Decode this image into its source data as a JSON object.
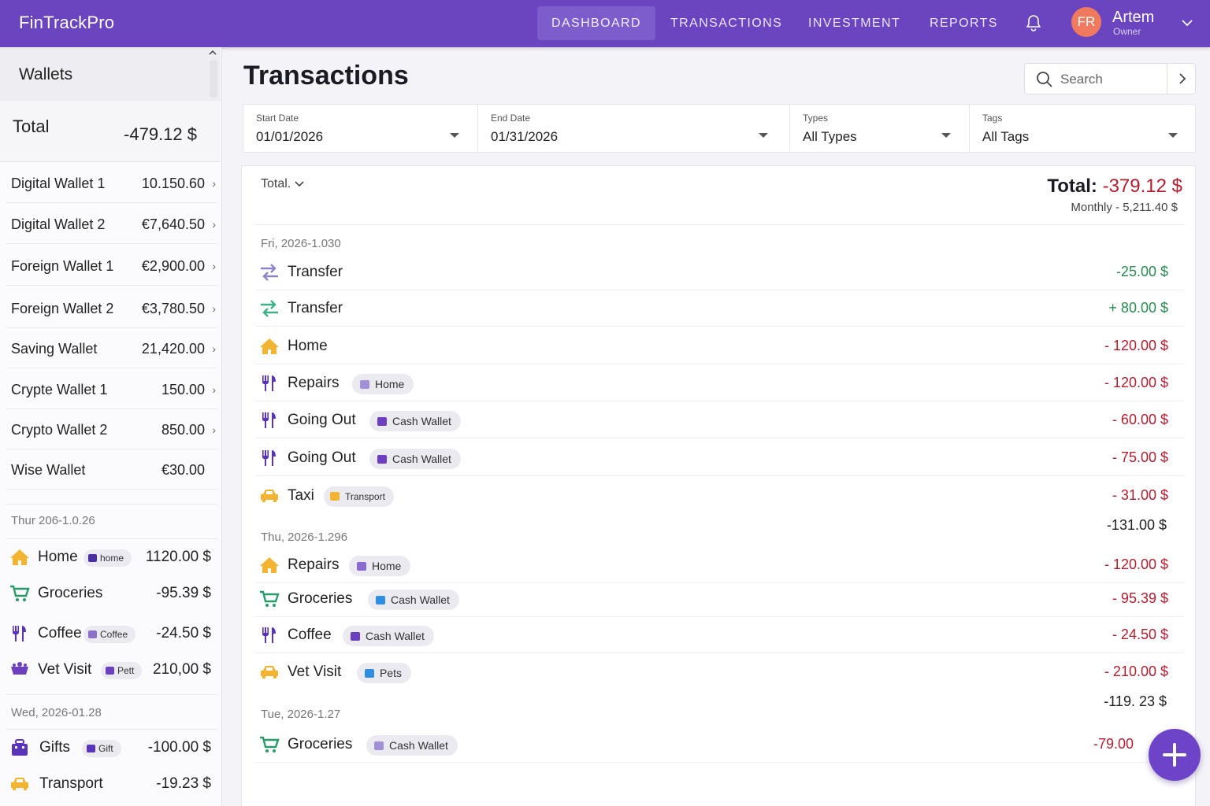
{
  "app": {
    "brand": "FinTrackPro",
    "nav": [
      "DASHBOARD",
      "TRANSACTIONS",
      "INVESTMENT",
      "REPORTS"
    ],
    "active_nav": "DASHBOARD",
    "user": {
      "initials": "FR",
      "name": "Artem",
      "role": "Owner"
    }
  },
  "sidebar": {
    "title": "Wallets",
    "total_label": "Total",
    "total_value": "-479.12 $",
    "wallets": [
      {
        "name": "Digital Wallet 1",
        "amount": "10.150.60"
      },
      {
        "name": "Digital Wallet 2",
        "amount": "€7,640.50"
      },
      {
        "name": "Foreign Wallet 1",
        "amount": "€2,900.00"
      },
      {
        "name": "Foreign Wallet 2",
        "amount": "€3,780.50"
      },
      {
        "name": "Saving Wallet",
        "amount": "21,420.00"
      },
      {
        "name": "Crypte Wallet 1",
        "amount": "150.00"
      },
      {
        "name": "Crypto Wallet 2",
        "amount": "850.00"
      },
      {
        "name": "Wise Wallet",
        "amount": "€30.00"
      }
    ],
    "groups": [
      {
        "date": "Thur 206-1.0.26",
        "items": [
          {
            "name": "Home",
            "tag": "home",
            "amount": "1120.00 $"
          },
          {
            "name": "Groceries",
            "tag": "",
            "amount": "-95.39 $"
          },
          {
            "name": "Coffee",
            "tag": "Coffee",
            "amount": "-24.50 $"
          },
          {
            "name": "Vet Visit",
            "tag": "Pett",
            "amount": "210,00 $"
          }
        ]
      },
      {
        "date": "Wed, 2026-01.28",
        "items": [
          {
            "name": "Gifts",
            "tag": "Gift",
            "amount": "-100.00 $"
          },
          {
            "name": "Transport",
            "tag": "",
            "amount": "-19.23 $"
          }
        ]
      }
    ]
  },
  "main": {
    "title": "Transactions",
    "search_placeholder": "Search",
    "filters": {
      "start_label": "Start Date",
      "start_value": "01/01/2026",
      "end_label": "End Date",
      "end_value": "01/31/2026",
      "types_label": "Types",
      "types_value": "All Types",
      "tags_label": "Tags",
      "tags_value": "All Tags"
    },
    "summary": {
      "selector": "Total.",
      "total_label": "Total:",
      "total_value": "-379.12 $",
      "monthly": "Monthly - 5,211.40 $"
    },
    "groups": [
      {
        "date": "Fri, 2026-1.030",
        "items": [
          {
            "name": "Transfer",
            "tag": "",
            "amount": "-25.00 $"
          },
          {
            "name": "Transfer",
            "tag": "",
            "amount": "+ 80.00 $"
          },
          {
            "name": "Home",
            "tag": "",
            "amount": "- 120.00 $"
          },
          {
            "name": "Repairs",
            "tag": "Home",
            "amount": "- 120.00 $"
          },
          {
            "name": "Going Out",
            "tag": "Cash Wallet",
            "amount": "- 60.00 $"
          },
          {
            "name": "Going Out",
            "tag": "Cash Wallet",
            "amount": "- 75.00 $"
          },
          {
            "name": "Taxi",
            "tag": "Transport",
            "amount": "- 31.00 $"
          }
        ],
        "subtotal": "-131.00 $"
      },
      {
        "date": "Thu, 2026-1.296",
        "items": [
          {
            "name": "Repairs",
            "tag": "Home",
            "amount": "- 120.00 $"
          },
          {
            "name": "Groceries",
            "tag": "Cash Wallet",
            "amount": "- 95.39 $"
          },
          {
            "name": "Coffee",
            "tag": "Cash Wallet",
            "amount": "- 24.50 $"
          },
          {
            "name": "Vet Visit",
            "tag": "Pets",
            "amount": "- 210.00 $"
          }
        ],
        "subtotal": "-119. 23 $"
      },
      {
        "date": "Tue, 2026-1.27",
        "items": [
          {
            "name": "Groceries",
            "tag": "Cash Wallet",
            "amount": "-79.00"
          }
        ]
      }
    ]
  },
  "colors": {
    "topbar": "#6a45bf",
    "negative": "#b31e2e",
    "positive": "#2a8a52",
    "fab": "#6d44c7"
  },
  "icons": [
    "bell-icon",
    "chevron-down-icon",
    "search-icon",
    "chevron-right-icon",
    "transfer-icon",
    "house-icon",
    "utensils-icon",
    "car-icon",
    "cart-icon",
    "pet-icon",
    "gift-icon",
    "plus-icon"
  ]
}
